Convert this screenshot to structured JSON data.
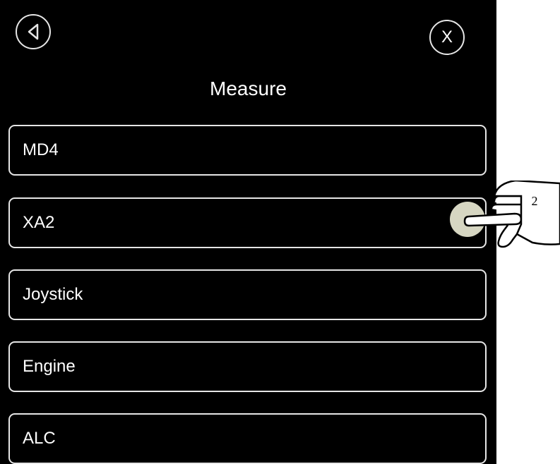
{
  "header": {
    "back_icon": "back-triangle-icon",
    "close_label": "X",
    "title": "Measure"
  },
  "menu": {
    "items": [
      {
        "label": "MD4"
      },
      {
        "label": "XA2"
      },
      {
        "label": "Joystick"
      },
      {
        "label": "Engine"
      },
      {
        "label": "ALC"
      }
    ]
  },
  "annotation": {
    "step_number": "2",
    "icon": "pointing-hand-icon",
    "target": "XA2"
  },
  "colors": {
    "background": "#000000",
    "foreground": "#ffffff",
    "border": "#e6e6e6",
    "tap_indicator": "#d6d6c2"
  }
}
